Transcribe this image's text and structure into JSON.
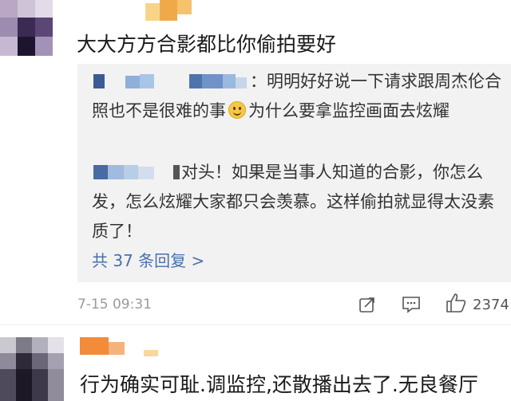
{
  "comment1": {
    "text": "大大方方合影都比你偷拍要好",
    "replies": [
      {
        "text": "：明明好好说一下请求跟周杰伦合照也不是很难的事"
      },
      {
        "text_after_emoji": "为什么要拿监控画面去炫耀"
      },
      {
        "text": "对头！如果是当事人知道的合影，你怎么发，怎么炫耀大家都只会羡慕。这样偷拍就显得太没素质了！"
      }
    ],
    "more_replies_label": "共 37 条回复 >",
    "timestamp": "7-15 09:31",
    "like_count": "2374"
  },
  "comment2": {
    "text": "行为确实可耻.调监控,还散播出去了.无良餐厅"
  },
  "icons": [
    "share-icon",
    "comment-icon",
    "like-icon",
    "smile-emoji"
  ],
  "colors": {
    "reply_bg": "#f2f2f2",
    "link": "#4a6fb0"
  }
}
